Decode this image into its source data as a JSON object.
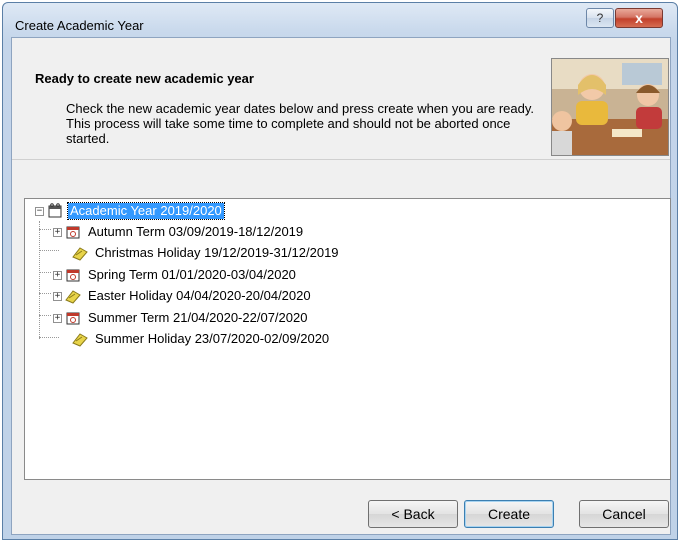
{
  "window": {
    "title": "Create Academic Year",
    "help_label": "?",
    "close_label": "x"
  },
  "header": {
    "title": "Ready to create new academic year",
    "description": "Check the new academic year dates below and press create when you are ready. This process will take some time to complete and should not be aborted once started."
  },
  "tree": {
    "root": {
      "label": "Academic Year 2019/2020",
      "expander": "−"
    },
    "children": [
      {
        "label": "Autumn Term 03/09/2019-18/12/2019",
        "type": "term",
        "expander": "+"
      },
      {
        "label": "Christmas Holiday 19/12/2019-31/12/2019",
        "type": "holiday",
        "expander": ""
      },
      {
        "label": "Spring Term 01/01/2020-03/04/2020",
        "type": "term",
        "expander": "+"
      },
      {
        "label": "Easter Holiday 04/04/2020-20/04/2020",
        "type": "holiday",
        "expander": "+"
      },
      {
        "label": "Summer Term 21/04/2020-22/07/2020",
        "type": "term",
        "expander": "+"
      },
      {
        "label": "Summer Holiday 23/07/2020-02/09/2020",
        "type": "holiday",
        "expander": ""
      }
    ]
  },
  "buttons": {
    "back": "< Back",
    "create": "Create",
    "cancel": "Cancel"
  },
  "colors": {
    "selection": "#3399ff",
    "holiday_icon": "#e8d44a",
    "term_icon": "#c0392b"
  }
}
